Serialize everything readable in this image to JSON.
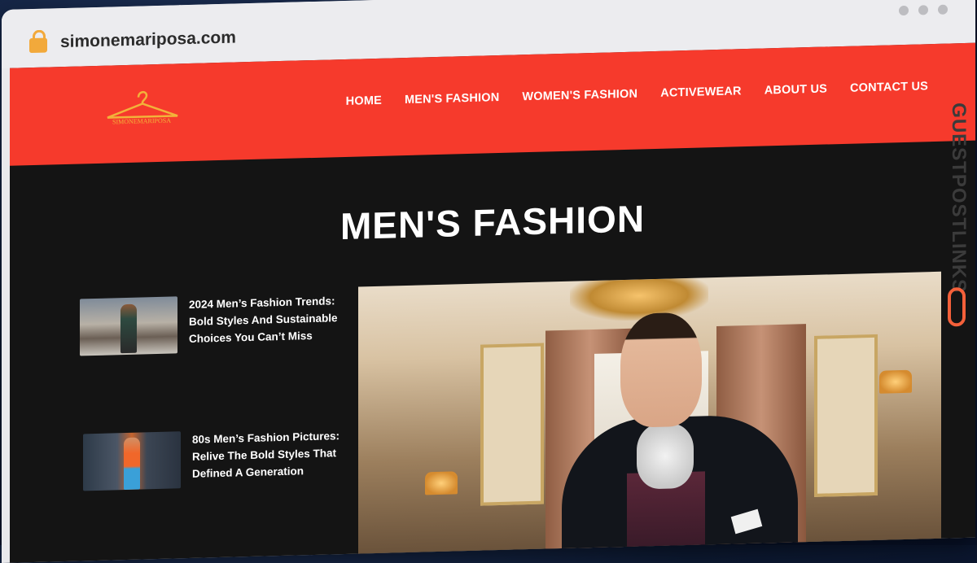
{
  "browser": {
    "url": "simonemariposa.com"
  },
  "site": {
    "logo_text": "SIMONEMARIPOSA",
    "nav": [
      {
        "label": "HOME"
      },
      {
        "label": "MEN'S FASHION"
      },
      {
        "label": "WOMEN'S FASHION"
      },
      {
        "label": "ACTIVEWEAR"
      },
      {
        "label": "ABOUT US"
      },
      {
        "label": "CONTACT US"
      }
    ],
    "page_title": "MEN'S FASHION",
    "posts": [
      {
        "title": "2024 Men’s Fashion Trends: Bold Styles And Sustainable Choices You Can’t Miss"
      },
      {
        "title": "80s Men’s Fashion Pictures: Relive The Bold Styles That Defined A Generation"
      }
    ]
  },
  "watermark": {
    "text": "GUESTPOSTLINKS"
  },
  "colors": {
    "header_bg": "#f63a2c",
    "page_bg": "#141414",
    "logo_gold": "#f2b23a",
    "watermark_accent": "#f4603a"
  }
}
